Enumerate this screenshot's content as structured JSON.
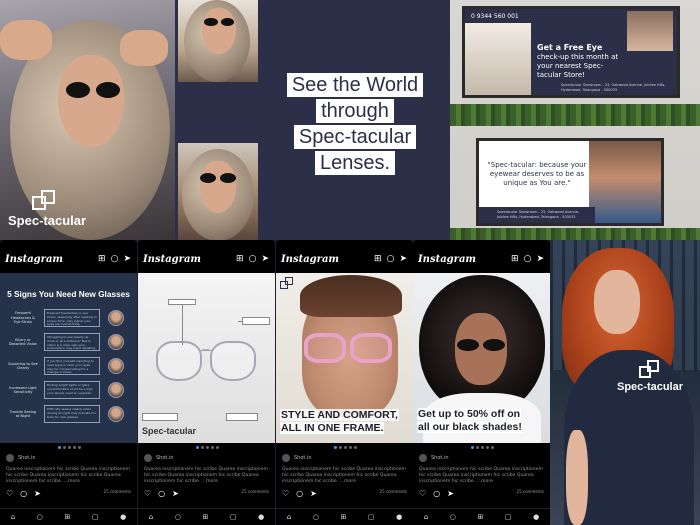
{
  "hero": {
    "tagline": [
      "See the World",
      "through",
      "Spec-tacular",
      "Lenses."
    ],
    "brand": "Spec-tacular"
  },
  "billboard1": {
    "phone": "0 9344 560 001",
    "headline": "Get a Free Eye",
    "body": "check-up this month at your nearest Spec-tacular Store!",
    "address": "Spectacular Showroom - 23, Oakwood Avenue, Jubilee Hills, Hyderabad, Telangana - 500033"
  },
  "billboard2": {
    "quote": "\"Spec-tacular: because your eyewear deserves to be as unique as You are.\"",
    "address": "Spectacular Showroom - 23, Oakwood Avenue, Jubilee Hills, Hyderabad, Telangana - 500033"
  },
  "instagram": {
    "app_name": "Instagram",
    "icons": [
      "add-icon",
      "search-icon",
      "send-icon"
    ],
    "nav_icons": [
      "home-icon",
      "search-icon",
      "add-icon",
      "shop-icon",
      "profile-icon"
    ],
    "username": "Shot.in",
    "caption": "Quarea inscriptionem hic scribe Quarea inscriptionem hic scribe Quarea inscriptionem hic scribe Quarea inscriptionem hic scribe. ...more",
    "comments_text": "25 comments",
    "posts": [
      {
        "title": "5 Signs You Need New Glasses",
        "signs": [
          {
            "label": "Frequent Headaches & Eye Strain",
            "text": "Frequent headaches or eye strain, especially after reading or screen time, may signal your eyes are overworking."
          },
          {
            "label": "Blurry or Distorted Vision",
            "text": "Struggling to see clearly up close or at a distance? Blurry vision is a clear sign your prescription may need updating."
          },
          {
            "label": "Squinting to See Clearly",
            "text": "If you find yourself squinting to read signs or text, your eyes may be compensating for a change in vision."
          },
          {
            "label": "Increased Light Sensitivity",
            "text": "Finding bright lights or glare uncomfortable could be a sign your lenses need an upgrade."
          },
          {
            "label": "Trouble Seeing at Night",
            "text": "Difficulty seeing clearly while driving at night may indicate it's time for new glasses."
          }
        ]
      },
      {
        "brand": "Spec-tacular"
      },
      {
        "headline": [
          "STYLE AND COMFORT,",
          "ALL IN ONE FRAME."
        ]
      },
      {
        "headline": [
          "Get up to 50% off on",
          "all our black shades!"
        ]
      }
    ]
  },
  "tshirt": {
    "brand": "Spec-tacular"
  }
}
